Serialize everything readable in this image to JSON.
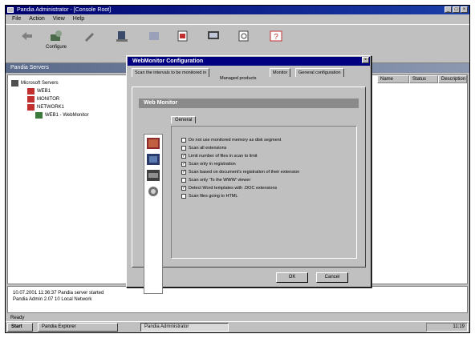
{
  "window": {
    "title": "Pandia Administrator - [Console Root]"
  },
  "menu": [
    "File",
    "Action",
    "View",
    "Help"
  ],
  "toolbar": [
    {
      "label": "",
      "icon": "back-icon"
    },
    {
      "label": "Configure",
      "icon": "configure-icon"
    },
    {
      "label": "",
      "icon": "tools-icon"
    },
    {
      "label": "",
      "icon": "server-icon"
    },
    {
      "label": "",
      "icon": "refresh-icon"
    },
    {
      "label": "",
      "icon": "properties-icon"
    },
    {
      "label": "",
      "icon": "monitor-icon"
    },
    {
      "label": "",
      "icon": "search-icon"
    },
    {
      "label": "",
      "icon": "help-icon"
    }
  ],
  "panel_header": "Pandia Servers",
  "tree": {
    "items": [
      {
        "label": "Microsoft Servers"
      },
      {
        "label": "WEB1"
      },
      {
        "label": "MONITOR"
      },
      {
        "label": "NETWORK1"
      },
      {
        "label": "WEB1 - WebMonitor"
      }
    ]
  },
  "list_columns": [
    "Name",
    "Status",
    "Description"
  ],
  "log": [
    "10.07.2001 11:36:37 Pandia server started",
    "Pandia Admin 2.07 10 Local Network"
  ],
  "status_text": "Ready",
  "taskbar": {
    "start": "Start",
    "items": [
      "Pandia Explorer",
      "Pandia Administrator"
    ],
    "clock": "11:19"
  },
  "dialog": {
    "title": "WebMonitor Configuration",
    "tabs_row1": [
      "Scan the intervals to be monitored in",
      "Monitor",
      "General configuration"
    ],
    "tabs_row2": "Managed products",
    "section_title": "Web Monitor",
    "general_tab": "General",
    "options": [
      {
        "label": "Do not use monitored memory as disk segment",
        "checked": false
      },
      {
        "label": "Scan all extensions",
        "checked": false
      },
      {
        "label": "Limit number of files in scan to limit",
        "checked": true
      },
      {
        "label": "Scan only in registration",
        "checked": true
      },
      {
        "label": "Scan based on document's registration of their extension",
        "checked": true
      },
      {
        "label": "Scan only 'To the WWW' viewer",
        "checked": false
      },
      {
        "label": "Detect Word templates with .DOC extensions",
        "checked": true
      },
      {
        "label": "Scan files going to HTML",
        "checked": false
      }
    ],
    "ok_label": "OK",
    "cancel_label": "Cancel"
  },
  "colors": {
    "titlebar": "#000080",
    "face": "#c0c0c0",
    "section_header": "#8a8a8a"
  }
}
